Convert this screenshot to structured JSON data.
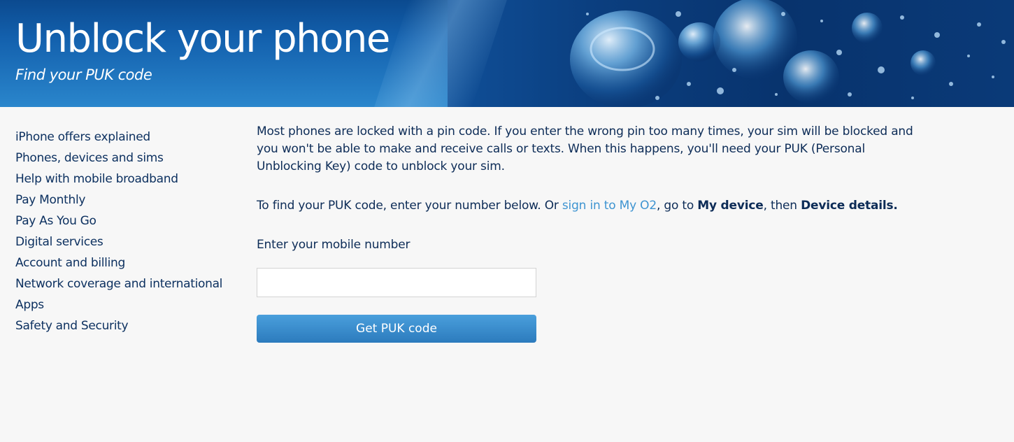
{
  "hero": {
    "title": "Unblock your phone",
    "subtitle": "Find your PUK code"
  },
  "sidebar": {
    "items": [
      {
        "label": "iPhone offers explained"
      },
      {
        "label": "Phones, devices and sims"
      },
      {
        "label": "Help with mobile broadband"
      },
      {
        "label": "Pay Monthly"
      },
      {
        "label": "Pay As You Go"
      },
      {
        "label": "Digital services"
      },
      {
        "label": "Account and billing"
      },
      {
        "label": "Network coverage and international"
      },
      {
        "label": "Apps"
      },
      {
        "label": "Safety and Security"
      }
    ]
  },
  "main": {
    "intro": "Most phones are locked with a pin code. If you enter the wrong pin too many times, your sim will be blocked and you won't be able to make and receive calls or texts. When this happens, you'll need your PUK (Personal Unblocking Key) code to unblock your sim.",
    "find_prefix": "To find your PUK code, enter your number below. Or ",
    "sign_in_link": "sign in to My O2",
    "find_middle": ", go to ",
    "my_device": "My device",
    "find_then": ", then ",
    "device_details": "Device details.",
    "field_label": "Enter your mobile number",
    "mobile_value": "",
    "button_label": "Get PUK code"
  }
}
